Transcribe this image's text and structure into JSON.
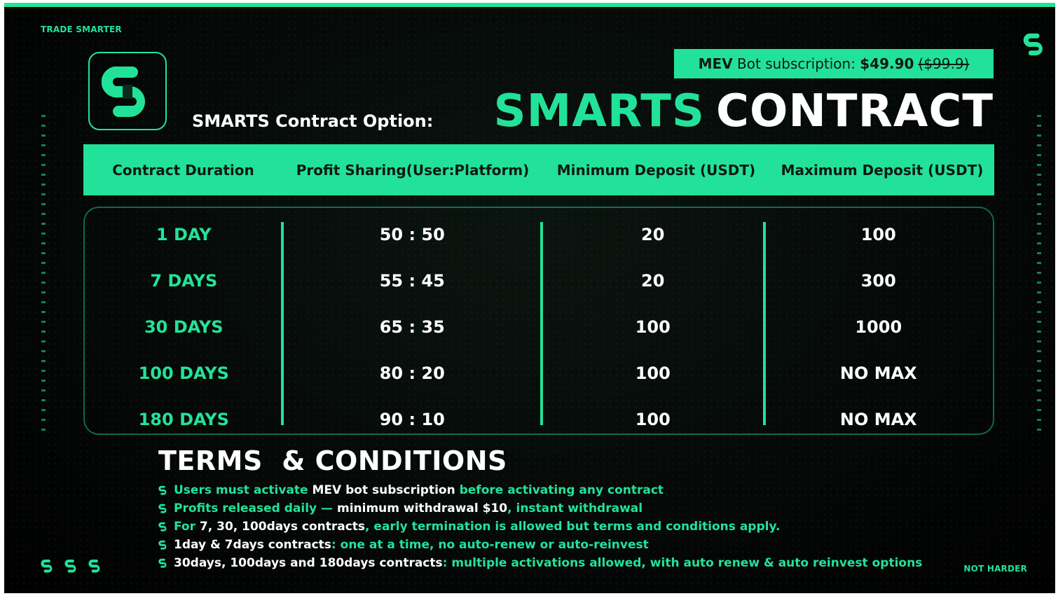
{
  "colors": {
    "accent": "#22e29a",
    "background": "#030605",
    "text": "#ffffff"
  },
  "brand": {
    "top_left": "TRADE SMARTER",
    "bottom_right": "NOT HARDER"
  },
  "logo": {
    "icon": "smarts-logo-icon"
  },
  "header": {
    "option_label": "SMARTS Contract Option:",
    "title_green": "SMARTS",
    "title_white": "CONTRACT",
    "subscription": {
      "prefix": "MEV",
      "label": " Bot subscription: ",
      "price": "$49.90",
      "old_price": "($99.9)"
    }
  },
  "table": {
    "headers": [
      "Contract Duration",
      "Profit Sharing(User:Platform)",
      "Minimum Deposit (USDT)",
      "Maximum Deposit (USDT)"
    ],
    "rows": [
      [
        "1 DAY",
        "50 : 50",
        "20",
        "100"
      ],
      [
        "7 DAYS",
        "55 : 45",
        "20",
        "300"
      ],
      [
        "30 DAYS",
        "65 : 35",
        "100",
        "1000"
      ],
      [
        "100 DAYS",
        "80 : 20",
        "100",
        "NO MAX"
      ],
      [
        "180 DAYS",
        "90 : 10",
        "100",
        "NO MAX"
      ]
    ]
  },
  "terms": {
    "title": "TERMS  & CONDITIONS",
    "items": [
      [
        {
          "t": "Users must activate ",
          "c": "g"
        },
        {
          "t": "MEV bot subscription ",
          "c": "w"
        },
        {
          "t": "before activating any contract",
          "c": "g"
        }
      ],
      [
        {
          "t": "Profits released daily — ",
          "c": "g"
        },
        {
          "t": "minimum withdrawal $10",
          "c": "w"
        },
        {
          "t": ", instant withdrawal",
          "c": "g"
        }
      ],
      [
        {
          "t": "For ",
          "c": "g"
        },
        {
          "t": "7, 30, 100days contracts",
          "c": "w"
        },
        {
          "t": ", early termination is allowed but terms and conditions apply.",
          "c": "g"
        }
      ],
      [
        {
          "t": "1day & 7days contracts",
          "c": "w"
        },
        {
          "t": ": one at a time, no auto-renew or auto-reinvest",
          "c": "g"
        }
      ],
      [
        {
          "t": "30days, 100days and 180days contracts",
          "c": "w"
        },
        {
          "t": ": multiple activations allowed, with auto renew & auto reinvest options",
          "c": "g"
        }
      ]
    ]
  }
}
